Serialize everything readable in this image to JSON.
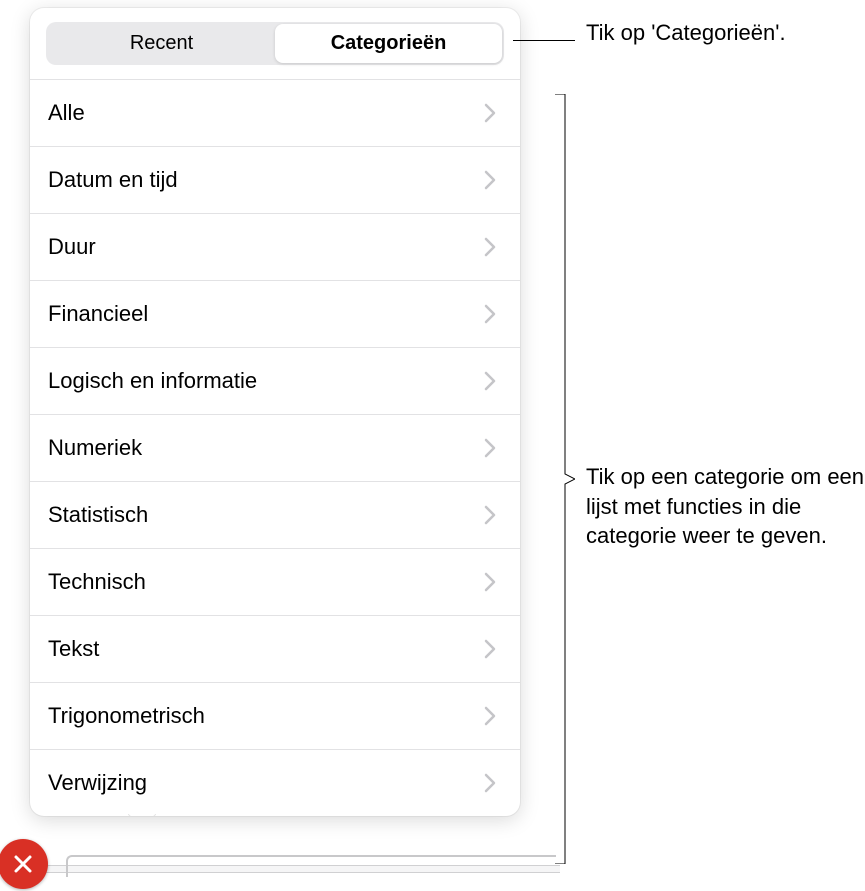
{
  "tabs": {
    "recent": "Recent",
    "categories": "Categorieën"
  },
  "categories": [
    "Alle",
    "Datum en tijd",
    "Duur",
    "Financieel",
    "Logisch en informatie",
    "Numeriek",
    "Statistisch",
    "Technisch",
    "Tekst",
    "Trigonometrisch",
    "Verwijzing"
  ],
  "callouts": {
    "top": "Tik op 'Categorieën'.",
    "mid": "Tik op een categorie om een lijst met functies in die categorie weer te geven."
  }
}
